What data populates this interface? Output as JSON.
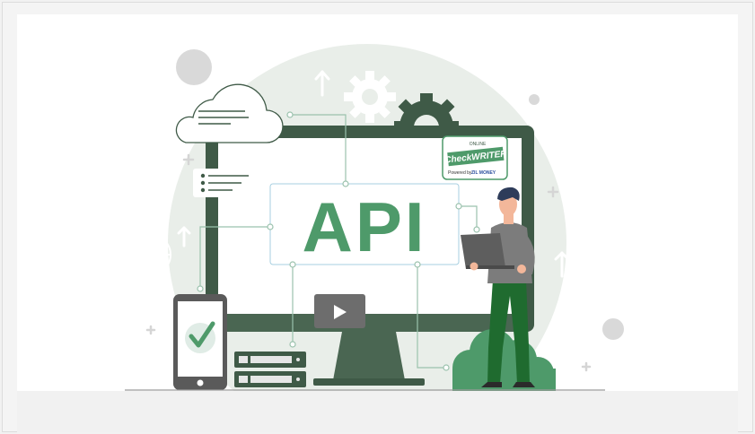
{
  "illustration": {
    "center_label": "API",
    "logo": {
      "tag": "ONLINE",
      "name": "CheckWRITER",
      "powered_by": "Powered by",
      "parent": "ZIL MONEY"
    }
  },
  "colors": {
    "dark_green": "#3f5a47",
    "accent_green": "#4e9a6a",
    "light_green_bg": "#e9eee9",
    "gray_circle": "#d9d9d9",
    "line_color": "#9bc2ad"
  }
}
